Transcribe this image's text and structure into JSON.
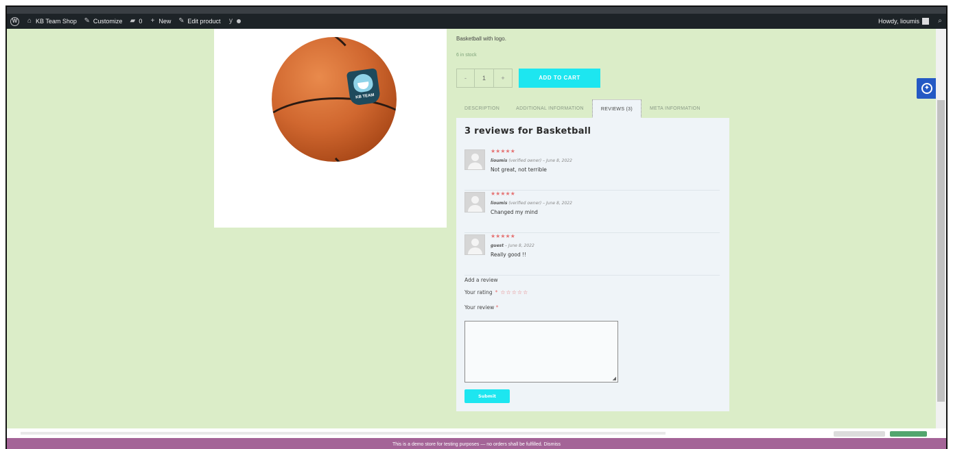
{
  "adminbar": {
    "site_name": "KB Team Shop",
    "customize": "Customize",
    "comments_count": "0",
    "new": "New",
    "edit_product": "Edit product",
    "howdy": "Howdy, lioumis"
  },
  "product": {
    "short_description": "Basketball with logo.",
    "stock": "6 in stock",
    "quantity": {
      "minus": "-",
      "value": "1",
      "plus": "+"
    },
    "add_to_cart": "ADD TO CART",
    "logo_text": "KB TEAM"
  },
  "tabs": [
    {
      "label": "DESCRIPTION",
      "active": false
    },
    {
      "label": "ADDITIONAL INFORMATION",
      "active": false
    },
    {
      "label": "REVIEWS (3)",
      "active": true
    },
    {
      "label": "META INFORMATION",
      "active": false
    }
  ],
  "reviews_panel": {
    "title": "3 reviews for Basketball",
    "reviews": [
      {
        "stars": "★★★★★",
        "author": "lioumis",
        "badge": "(verified owner)",
        "date": "June 8, 2022",
        "text": "Not great, not terrible"
      },
      {
        "stars": "★★★★★",
        "author": "lioumis",
        "badge": "(verified owner)",
        "date": "June 8, 2022",
        "text": "Changed my mind"
      },
      {
        "stars": "★★★★★",
        "author": "guest",
        "badge": "",
        "date": "June 8, 2022",
        "text": "Really good !!"
      }
    ],
    "add_review": "Add a review",
    "your_rating": "Your rating",
    "required_mark": "*",
    "empty_stars": "☆☆☆☆☆",
    "your_review": "Your review",
    "submit": "Submit"
  },
  "demo_notice": "This is a demo store for testing purposes — no orders shall be fulfilled. Dismiss",
  "colors": {
    "page_bg": "#dbedc8",
    "accent": "#1de6f0",
    "admin_bar": "#1d2327",
    "notice_bar": "#a46497",
    "star": "#e57373"
  },
  "icons": [
    "wordpress-icon",
    "site-icon",
    "customize-icon",
    "comment-icon",
    "plus-icon",
    "edit-icon",
    "yoast-icon",
    "search-icon",
    "accessibility-icon"
  ]
}
